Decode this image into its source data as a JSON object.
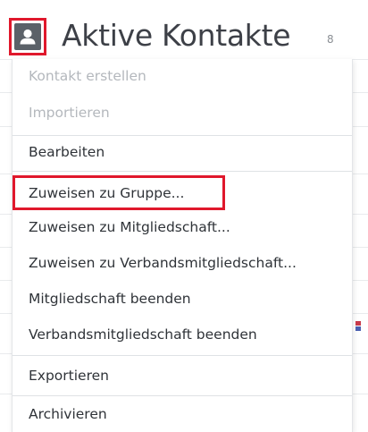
{
  "header": {
    "title": "Aktive Kontakte",
    "count": "8",
    "user_button_icon": "user-icon"
  },
  "menu": {
    "items": [
      {
        "label": "Kontakt erstellen",
        "enabled": false
      },
      {
        "label": "Importieren",
        "enabled": false
      },
      {
        "label": "Bearbeiten",
        "enabled": true
      },
      {
        "label": "Zuweisen zu Gruppe...",
        "enabled": true,
        "highlighted": true
      },
      {
        "label": "Zuweisen zu Mitgliedschaft...",
        "enabled": true
      },
      {
        "label": "Zuweisen zu Verbandsmitgliedschaft...",
        "enabled": true
      },
      {
        "label": "Mitgliedschaft beenden",
        "enabled": true
      },
      {
        "label": "Verbandsmitgliedschaft beenden",
        "enabled": true
      },
      {
        "label": "Exportieren",
        "enabled": true
      },
      {
        "label": "Archivieren",
        "enabled": true
      }
    ]
  },
  "colors": {
    "highlight": "#e0182c",
    "text": "#2f3338",
    "disabled_text": "#b4b8bd",
    "icon_bg": "#5b6168"
  }
}
